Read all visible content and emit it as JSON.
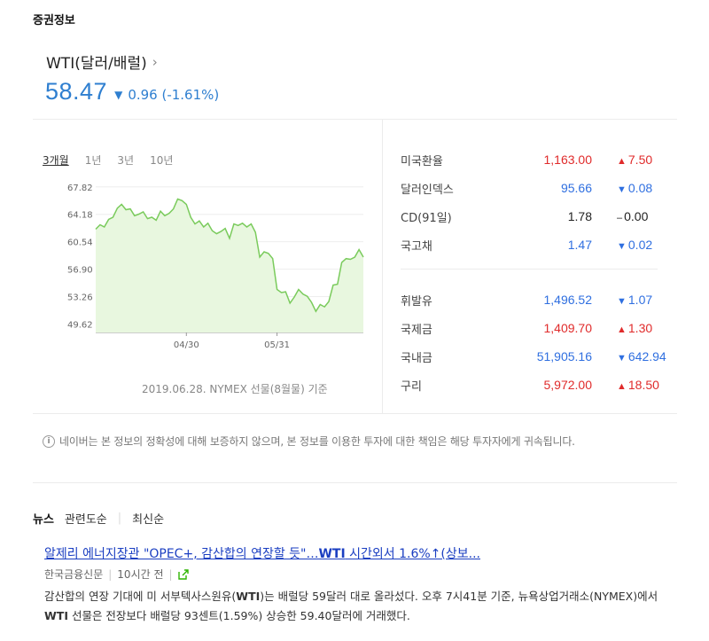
{
  "section_title": "증권정보",
  "stock": {
    "name": "WTI(달러/배럴)",
    "price": "58.47",
    "change_arrow": "▼",
    "change": "0.96 (-1.61%)"
  },
  "chart": {
    "tabs": [
      "3개월",
      "1년",
      "3년",
      "10년"
    ],
    "active_tab": "3개월",
    "caption": "2019.06.28. NYMEX 선물(8월물) 기준",
    "line_color": "#7acb5c",
    "fill_color": "#e8f7df"
  },
  "chart_data": {
    "type": "area",
    "ylim": [
      48.5,
      68.5
    ],
    "y_ticks": [
      "67.82",
      "64.18",
      "60.54",
      "56.90",
      "53.26",
      "49.62"
    ],
    "x_ticks": [
      "04/30",
      "05/31"
    ],
    "values": [
      62.2,
      62.8,
      62.5,
      63.5,
      63.8,
      65.0,
      65.5,
      64.8,
      64.9,
      64.0,
      64.2,
      64.5,
      63.6,
      63.8,
      63.4,
      64.6,
      64.0,
      64.3,
      64.9,
      66.2,
      66.0,
      65.5,
      63.8,
      62.9,
      63.3,
      62.5,
      63.0,
      62.0,
      61.6,
      61.9,
      62.3,
      61.0,
      62.9,
      62.7,
      63.0,
      62.5,
      62.9,
      61.8,
      58.5,
      59.2,
      59.0,
      58.3,
      54.2,
      53.8,
      53.9,
      52.4,
      53.2,
      54.2,
      53.6,
      53.3,
      52.5,
      51.3,
      52.2,
      51.9,
      52.6,
      54.8,
      54.9,
      57.8,
      58.3,
      58.2,
      58.5,
      59.5,
      58.5
    ]
  },
  "quotes_group1": [
    {
      "name": "미국환율",
      "value": "1,163.00",
      "dir": "up",
      "change": "7.50"
    },
    {
      "name": "달러인덱스",
      "value": "95.66",
      "dir": "down",
      "change": "0.08"
    },
    {
      "name": "CD(91일)",
      "value": "1.78",
      "dir": "flat",
      "change": "0.00"
    },
    {
      "name": "국고채",
      "value": "1.47",
      "dir": "down",
      "change": "0.02"
    }
  ],
  "quotes_group2": [
    {
      "name": "휘발유",
      "value": "1,496.52",
      "dir": "down",
      "change": "1.07"
    },
    {
      "name": "국제금",
      "value": "1,409.70",
      "dir": "up",
      "change": "1.30"
    },
    {
      "name": "국내금",
      "value": "51,905.16",
      "dir": "down",
      "change": "642.94"
    },
    {
      "name": "구리",
      "value": "5,972.00",
      "dir": "up",
      "change": "18.50"
    }
  ],
  "notice": "네이버는 본 정보의 정확성에 대해 보증하지 않으며, 본 정보를 이용한 투자에 대한 책임은 해당 투자자에게 귀속됩니다.",
  "news": {
    "label": "뉴스",
    "tabs": [
      "관련도순",
      "최신순"
    ],
    "headline_pre": "알제리 에너지장관 \"OPEC+, 감산합의 연장할 듯\"…",
    "headline_bold": "WTI",
    "headline_post": " 시간외서 1.6%↑(상보...",
    "source": "한국금융신문",
    "time": "10시간 전",
    "summary_1": "감산합의 연장 기대에 미 서부텍사스원유(",
    "summary_b1": "WTI",
    "summary_2": ")는 배럴당 59달러 대로 올라섰다. 오후 7시41분 기준, 뉴욕상업거래소(NYMEX)에서 ",
    "summary_b2": "WTI",
    "summary_3": " 선물은 전장보다 배럴당 93센트(1.59%) 상승한 59.40달러에 거래했다."
  }
}
